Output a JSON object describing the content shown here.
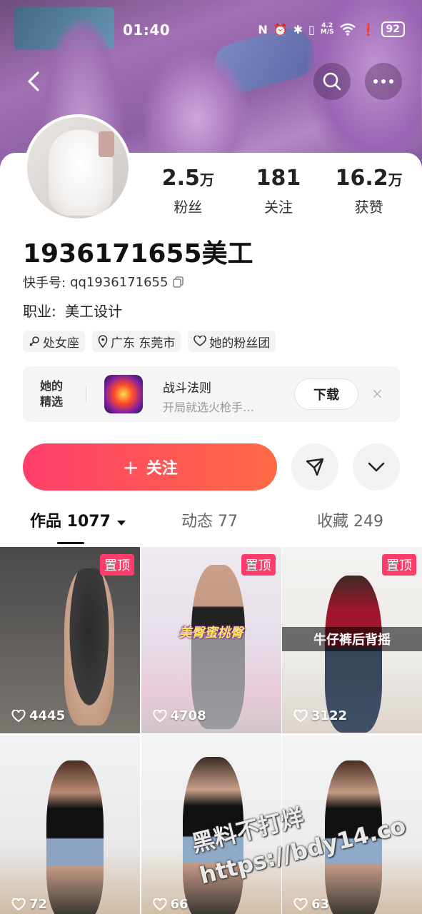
{
  "status_bar": {
    "time": "01:40",
    "net_speed_value": "4.2",
    "net_speed_unit": "M/S",
    "battery": "92"
  },
  "stats": [
    {
      "num": "2.5",
      "unit": "万",
      "label": "粉丝"
    },
    {
      "num": "181",
      "unit": "",
      "label": "关注"
    },
    {
      "num": "16.2",
      "unit": "万",
      "label": "获赞"
    }
  ],
  "profile": {
    "username": "1936171655美工",
    "id_label": "快手号:",
    "id_value": "qq1936171655",
    "job_label": "职业:",
    "job_value": "美工设计"
  },
  "tags": [
    "处女座",
    "广东 东莞市",
    "她的粉丝团"
  ],
  "promo": {
    "label_line1": "她的",
    "label_line2": "精选",
    "app_title": "战斗法则",
    "app_sub": "开局就选火枪手…",
    "download_label": "下载",
    "close_glyph": "×"
  },
  "actions": {
    "follow_label": "关注",
    "follow_plus": "+"
  },
  "tabs": [
    {
      "label": "作品 1077",
      "active": true
    },
    {
      "label": "动态 77",
      "active": false
    },
    {
      "label": "收藏 249",
      "active": false
    }
  ],
  "videos": [
    {
      "likes": "4445",
      "pinned": true,
      "pin_label": "置顶",
      "caption": ""
    },
    {
      "likes": "4708",
      "pinned": true,
      "pin_label": "置顶",
      "caption": "美臀蜜桃臀"
    },
    {
      "likes": "3122",
      "pinned": true,
      "pin_label": "置顶",
      "caption": "牛仔裤后背摇"
    },
    {
      "likes": "72",
      "pinned": false,
      "pin_label": "",
      "caption": ""
    },
    {
      "likes": "66",
      "pinned": false,
      "pin_label": "",
      "caption": ""
    },
    {
      "likes": "63",
      "pinned": false,
      "pin_label": "",
      "caption": ""
    }
  ],
  "watermark": {
    "line1": "黑料不打烊",
    "line2": "https://bdy14.co"
  },
  "colors": {
    "accent": "#FE3C6A",
    "follow_gradient_start": "#FF3E6B",
    "follow_gradient_end": "#FF6A45"
  }
}
